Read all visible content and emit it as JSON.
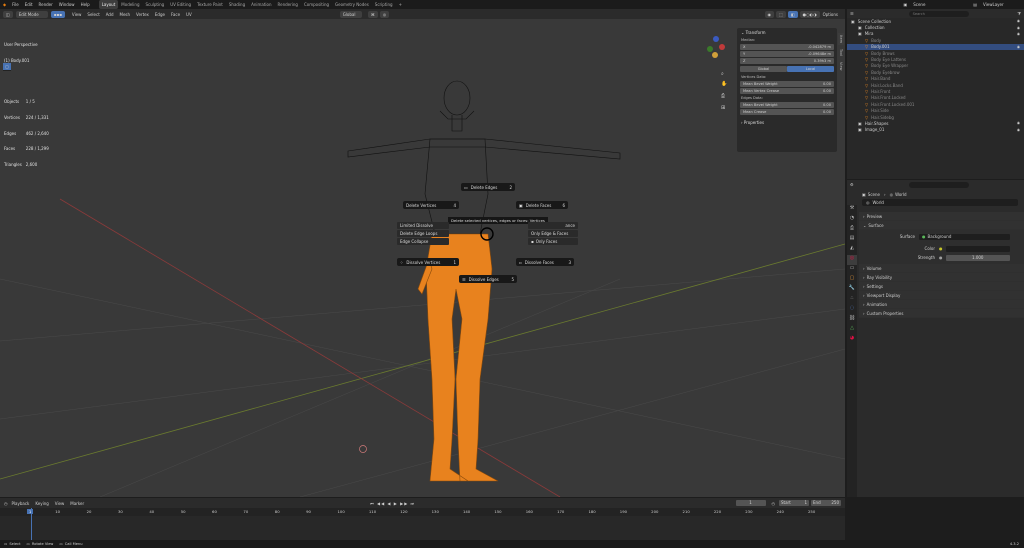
{
  "topbar": {
    "menus": [
      "File",
      "Edit",
      "Render",
      "Window",
      "Help"
    ],
    "workspaces": [
      "Layout",
      "Modeling",
      "Sculpting",
      "UV Editing",
      "Texture Paint",
      "Shading",
      "Animation",
      "Rendering",
      "Compositing",
      "Geometry Nodes",
      "Scripting"
    ],
    "active_workspace": "Layout",
    "scene": "Scene",
    "view_layer": "ViewLayer"
  },
  "header": {
    "mode": "Edit Mode",
    "menus": [
      "View",
      "Select",
      "Add",
      "Mesh",
      "Vertex",
      "Edge",
      "Face",
      "UV"
    ],
    "orientation": "Global",
    "options": "Options"
  },
  "viewport_info": {
    "view": "User Perspective",
    "object": "(1) Body.001",
    "stats": [
      {
        "label": "Objects",
        "value": "1 / 5"
      },
      {
        "label": "Vertices",
        "value": "224 / 1,331"
      },
      {
        "label": "Edges",
        "value": "462 / 2,640"
      },
      {
        "label": "Faces",
        "value": "228 / 1,299"
      },
      {
        "label": "Triangles",
        "value": "2,600"
      }
    ]
  },
  "pie_menu": {
    "items": [
      "Delete Edges",
      "Delete Vertices",
      "Delete Faces",
      "Dissolve Vertices",
      "Dissolve Faces",
      "Dissolve Edges"
    ],
    "hotkeys": {
      "Delete Edges": "2",
      "Delete Vertices": "4",
      "Delete Faces": "6",
      "Dissolve Vertices": "1",
      "Dissolve Faces": "3",
      "Dissolve Edges": "5"
    },
    "tooltip": "Delete selected vertices, edges or faces: Vertices",
    "left_list": [
      "Limited Dissolve",
      "Delete Edge Loops",
      "Edge Collapse"
    ],
    "right_list": [
      "Only Edge & Faces",
      "Only Faces"
    ],
    "right_partial": "ance"
  },
  "npanel": {
    "tabs": [
      "Item",
      "Tool",
      "View"
    ],
    "transform_title": "Transform",
    "median_label": "Median:",
    "fields": [
      {
        "label": "X",
        "value": "-0.042879 m"
      },
      {
        "label": "Y",
        "value": "-0.09648e m"
      },
      {
        "label": "Z",
        "value": "0.39h3 m"
      }
    ],
    "global": "Global",
    "local": "Local",
    "vertices_data": "Vertices Data:",
    "vertex_fields": [
      {
        "label": "Mean Bevel Weight",
        "value": "0.00"
      },
      {
        "label": "Mean Vertex Crease",
        "value": "0.00"
      }
    ],
    "edges_data": "Edges Data:",
    "edge_fields": [
      {
        "label": "Mean Bevel Weight",
        "value": "0.00"
      },
      {
        "label": "Mean Crease",
        "value": "0.00"
      }
    ],
    "properties": "Properties"
  },
  "outliner": {
    "search_placeholder": "Search",
    "rows": [
      {
        "label": "Scene Collection",
        "indent": 0,
        "sel": false
      },
      {
        "label": "Collection",
        "indent": 1,
        "sel": false
      },
      {
        "label": "Mira",
        "indent": 1,
        "sel": false
      },
      {
        "label": "Body",
        "indent": 2,
        "sel": false
      },
      {
        "label": "Body.001",
        "indent": 2,
        "sel": true
      },
      {
        "label": "Body Brows",
        "indent": 2,
        "sel": false
      },
      {
        "label": "Body Eye Lattens",
        "indent": 2,
        "sel": false
      },
      {
        "label": "Body Eye Wrapper",
        "indent": 2,
        "sel": false
      },
      {
        "label": "Body Eyebrow",
        "indent": 2,
        "sel": false
      },
      {
        "label": "Hair.Band",
        "indent": 2,
        "sel": false
      },
      {
        "label": "Hair.Locks.Band",
        "indent": 2,
        "sel": false
      },
      {
        "label": "Hair.Front",
        "indent": 2,
        "sel": false
      },
      {
        "label": "Hair.Front.Locked",
        "indent": 2,
        "sel": false
      },
      {
        "label": "Hair.Front.Locked.001",
        "indent": 2,
        "sel": false
      },
      {
        "label": "Hair.Side",
        "indent": 2,
        "sel": false
      },
      {
        "label": "Hair.Sidebg",
        "indent": 2,
        "sel": false
      },
      {
        "label": "Hair.Shapes",
        "indent": 1,
        "sel": false
      },
      {
        "label": "Image_01",
        "indent": 1,
        "sel": false
      }
    ]
  },
  "properties": {
    "breadcrumb": [
      "Scene",
      "World"
    ],
    "world_name": "World",
    "sections": [
      "Preview",
      "Surface"
    ],
    "surface_label": "Surface",
    "surface_value": "Background",
    "color_label": "Color",
    "strength_label": "Strength",
    "strength_value": "1.000",
    "more_sections": [
      "Volume",
      "Ray Visibility",
      "Settings",
      "Viewport Display",
      "Animation",
      "Custom Properties"
    ]
  },
  "timeline": {
    "menus": [
      "Playback",
      "Keying",
      "View",
      "Marker"
    ],
    "current_frame": "1",
    "start_label": "Start",
    "start": "1",
    "end_label": "End",
    "end": "250",
    "ticks": [
      "1",
      "10",
      "20",
      "30",
      "40",
      "50",
      "60",
      "70",
      "80",
      "90",
      "100",
      "110",
      "120",
      "130",
      "140",
      "150",
      "160",
      "170",
      "180",
      "190",
      "200",
      "210",
      "220",
      "230",
      "240",
      "250"
    ]
  },
  "status": {
    "items": [
      "Select",
      "Rotate View",
      "Call Menu"
    ],
    "version": "4.3.2"
  },
  "colors": {
    "accent": "#4772b3",
    "mesh": "#f08c20",
    "selected_row": "#334d80"
  }
}
